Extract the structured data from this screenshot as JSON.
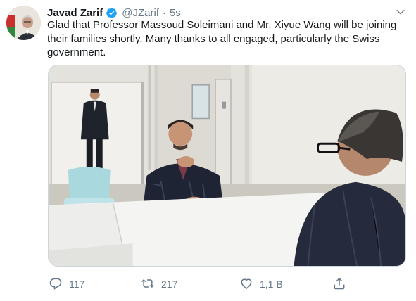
{
  "tweet": {
    "author_name": "Javad Zarif",
    "handle": "@JZarif",
    "separator": "·",
    "time": "5s",
    "text": "Glad that Professor Massoud Soleimani and Mr. Xiyue Wang will be joining their families shortly.  Many thanks to all engaged, particularly the Swiss government.",
    "verified": true
  },
  "actions": {
    "replies": "117",
    "retweets": "217",
    "likes": "1,1 B"
  },
  "icons": {
    "verified": "verified-badge-icon",
    "caret": "chevron-down-icon",
    "reply": "reply-icon",
    "retweet": "retweet-icon",
    "like": "heart-icon",
    "share": "share-icon"
  },
  "colors": {
    "verified": "#1da1f2",
    "secondary_text": "#657786",
    "primary_text": "#14171a"
  }
}
